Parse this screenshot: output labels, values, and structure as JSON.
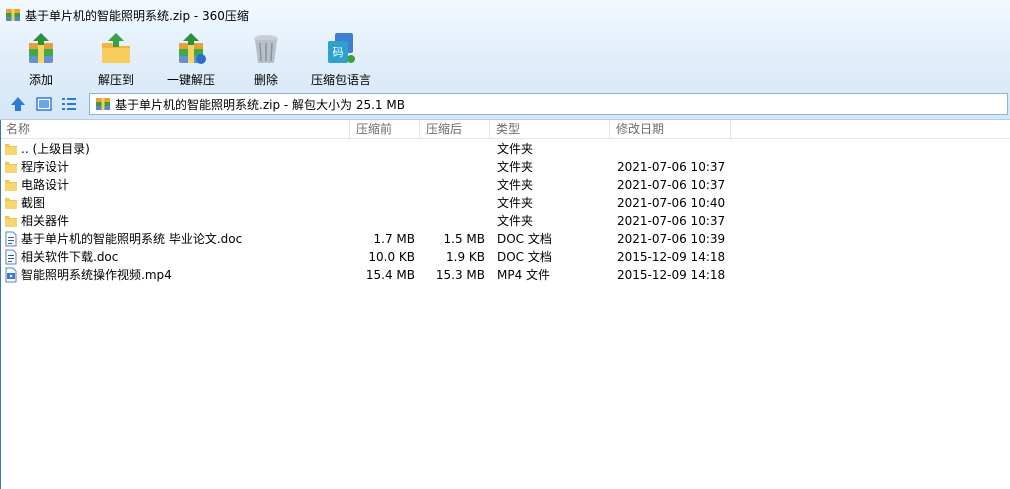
{
  "window": {
    "title": "基于单片机的智能照明系统.zip - 360压缩"
  },
  "toolbar": {
    "items": [
      {
        "label": "添加",
        "icon": "add-icon"
      },
      {
        "label": "解压到",
        "icon": "extract-to-icon"
      },
      {
        "label": "一键解压",
        "icon": "one-click-extract-icon"
      },
      {
        "label": "删除",
        "icon": "delete-icon"
      },
      {
        "label": "压缩包语言",
        "icon": "archive-language-icon"
      }
    ]
  },
  "address": {
    "text": "基于单片机的智能照明系统.zip - 解包大小为 25.1 MB"
  },
  "columns": {
    "name": "名称",
    "size": "压缩前",
    "packed": "压缩后",
    "type": "类型",
    "date": "修改日期"
  },
  "files": [
    {
      "name": ".. (上级目录)",
      "size": "",
      "packed": "",
      "type": "文件夹",
      "date": "",
      "icon": "folder-icon"
    },
    {
      "name": "程序设计",
      "size": "",
      "packed": "",
      "type": "文件夹",
      "date": "2021-07-06 10:37",
      "icon": "folder-icon"
    },
    {
      "name": "电路设计",
      "size": "",
      "packed": "",
      "type": "文件夹",
      "date": "2021-07-06 10:37",
      "icon": "folder-icon"
    },
    {
      "name": "截图",
      "size": "",
      "packed": "",
      "type": "文件夹",
      "date": "2021-07-06 10:40",
      "icon": "folder-icon"
    },
    {
      "name": "相关器件",
      "size": "",
      "packed": "",
      "type": "文件夹",
      "date": "2021-07-06 10:37",
      "icon": "folder-icon"
    },
    {
      "name": "基于单片机的智能照明系统 毕业论文.doc",
      "size": "1.7 MB",
      "packed": "1.5 MB",
      "type": "DOC 文档",
      "date": "2021-07-06 10:39",
      "icon": "doc-file-icon"
    },
    {
      "name": "相关软件下载.doc",
      "size": "10.0 KB",
      "packed": "1.9 KB",
      "type": "DOC 文档",
      "date": "2015-12-09 14:18",
      "icon": "doc-file-icon"
    },
    {
      "name": "智能照明系统操作视频.mp4",
      "size": "15.4 MB",
      "packed": "15.3 MB",
      "type": "MP4 文件",
      "date": "2015-12-09 14:18",
      "icon": "video-file-icon"
    }
  ]
}
